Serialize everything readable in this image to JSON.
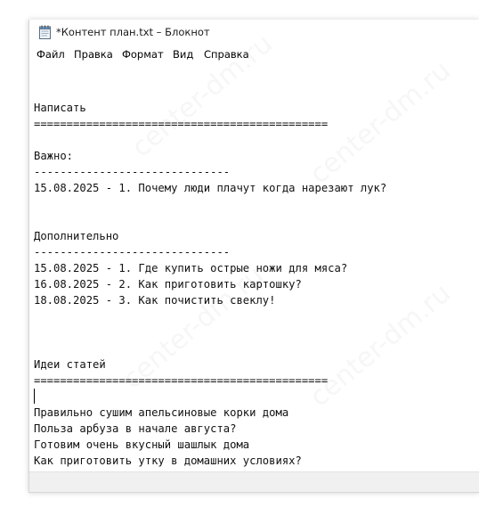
{
  "window": {
    "title": "*Контент план.txt – Блокнот"
  },
  "menu": [
    {
      "label": "Файл"
    },
    {
      "label": "Правка"
    },
    {
      "label": "Формат"
    },
    {
      "label": "Вид"
    },
    {
      "label": "Справка"
    }
  ],
  "editor": {
    "lines": [
      "",
      "",
      "Написать",
      "=============================================",
      "",
      "Важно:",
      "------------------------------",
      "15.08.2025 - 1. Почему люди плачут когда нарезают лук?",
      "",
      "",
      "Дополнительно",
      "------------------------------",
      "15.08.2025 - 1. Где купить острые ножи для мяса?",
      "16.08.2025 - 2. Как приготовить картошку?",
      "18.08.2025 - 3. Как почистить свеклу!",
      "",
      "",
      "",
      "Идеи статей",
      "=============================================",
      "",
      "Правильно сушим апельсиновые корки дома",
      "Польза арбуза в начале августа?",
      "Готовим очень вкусный шашлык дома",
      "Как приготовить утку в домашних условиях?"
    ],
    "caret_line": 20
  },
  "watermark": {
    "text": "center-dm.ru"
  }
}
